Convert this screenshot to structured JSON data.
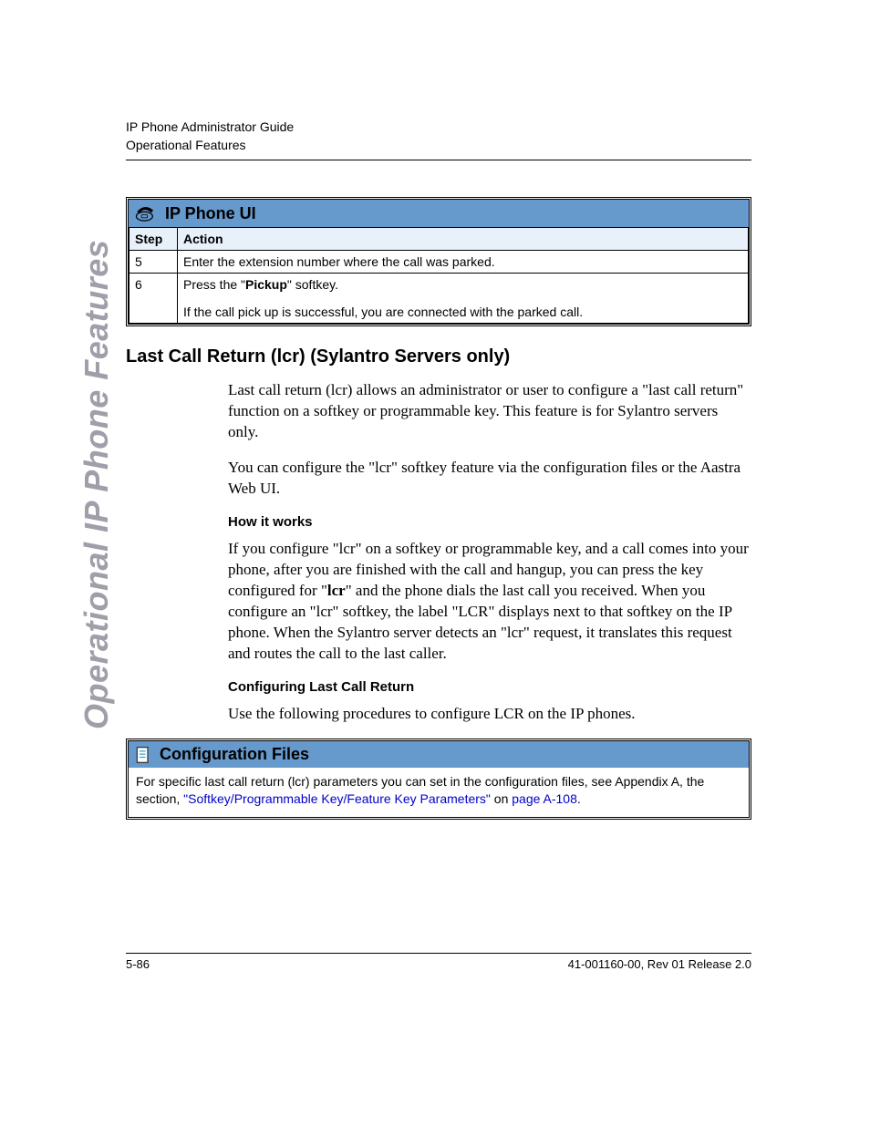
{
  "header": {
    "line1": "IP Phone Administrator Guide",
    "line2": "Operational Features"
  },
  "side_tab": "Operational IP Phone Features",
  "panel1": {
    "title": "IP Phone UI",
    "columns": {
      "step": "Step",
      "action": "Action"
    },
    "rows": [
      {
        "step": "5",
        "action_plain": "Enter the extension number where the call was parked."
      },
      {
        "step": "6",
        "action_pre": "Press the \"",
        "action_bold": "Pickup",
        "action_post": "\" softkey.",
        "action_line2": "If the call pick up is successful, you are connected with the parked call."
      }
    ]
  },
  "section": {
    "title": "Last Call Return (lcr) (Sylantro Servers only)",
    "p1": "Last call return (lcr) allows an administrator or user to configure a \"last call return\" function on a softkey or programmable key. This feature is for Sylantro servers only.",
    "p2": "You can configure the \"lcr\" softkey feature via the configuration files or the Aastra Web UI.",
    "h_how": "How it works",
    "p3_pre": "If you configure \"lcr\" on a softkey or programmable key, and a call comes into your phone, after you are finished with the call and hangup, you can press the key configured for \"",
    "p3_bold": "lcr",
    "p3_post": "\" and the phone dials the last call you received. When you configure an \"lcr\" softkey, the label \"LCR\" displays next to that softkey on the IP phone. When the Sylantro server detects an \"lcr\" request, it translates this request and routes the call to the last caller.",
    "h_cfg": "Configuring Last Call Return",
    "p4": "Use the following procedures to configure LCR on the IP phones."
  },
  "panel2": {
    "title": "Configuration Files",
    "body_pre": "For specific last call return (lcr) parameters you can set in the configuration files, see Appendix A, the section, ",
    "link_text": "\"Softkey/Programmable Key/Feature Key Parameters\"",
    "body_mid": " on ",
    "page_link": "page A-108",
    "body_post": "."
  },
  "footer": {
    "left": "5-86",
    "right": "41-001160-00, Rev 01 Release 2.0"
  }
}
